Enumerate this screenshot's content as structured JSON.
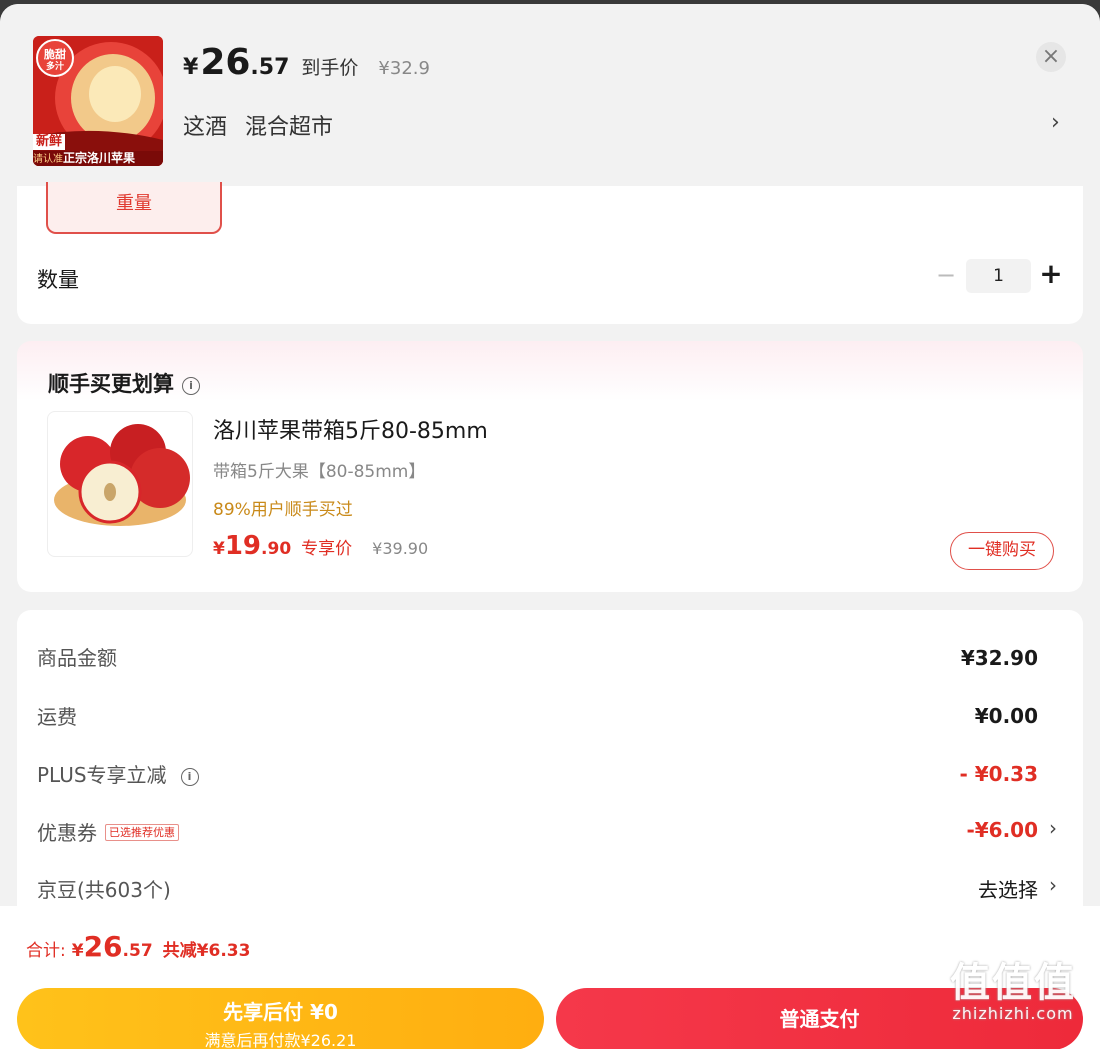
{
  "header": {
    "currency": "¥",
    "price_int": "26",
    "price_dec": ".57",
    "price_tag": "到手价",
    "original_price": "¥32.9",
    "store_names": [
      "这酒",
      "混合超市"
    ],
    "thumb_badge_top": "脆甜",
    "thumb_badge_sub": "多汁",
    "thumb_tag_new": "新鲜",
    "thumb_tag_verify": "请认准",
    "thumb_caption": "正宗洛川苹果",
    "close_icon": "×",
    "chevron": "›"
  },
  "spec": {
    "option_label": "重量",
    "quantity_label": "数量",
    "quantity_value": "1",
    "minus": "−",
    "plus": "+"
  },
  "recommend": {
    "section_title": "顺手买更划算",
    "info_icon": "i",
    "product_title": "洛川苹果带箱5斤80-85mm",
    "spec": "带箱5斤大果【80-85mm】",
    "social_proof": "89%用户顺手买过",
    "currency": "¥",
    "price_int": "19",
    "price_dec": ".90",
    "price_tag": "专享价",
    "original_price": "¥39.90",
    "buy_button": "一键购买"
  },
  "summary": {
    "rows": [
      {
        "label": "商品金额",
        "value": "¥32.90"
      },
      {
        "label": "运费",
        "value": "¥0.00"
      },
      {
        "label": "PLUS专享立减",
        "value": "- ¥0.33"
      },
      {
        "label": "优惠券",
        "badge": "已选推荐优惠",
        "value": "-¥6.00"
      },
      {
        "label": "京豆(共603个)",
        "value": "去选择"
      }
    ]
  },
  "footer": {
    "total_label": "合计:",
    "currency": "¥",
    "total_int": "26",
    "total_dec": ".57",
    "savings": "共减¥6.33",
    "pay_later_line1": "先享后付 ¥0",
    "pay_later_line2": "满意后再付款¥26.21",
    "pay_normal": "普通支付"
  },
  "watermark": {
    "line1": "值值值",
    "line2": "zhizhizhi.com"
  },
  "colors": {
    "accent_red": "#e02e24",
    "gold": "#ffb815",
    "social_gold": "#c98a1a"
  }
}
